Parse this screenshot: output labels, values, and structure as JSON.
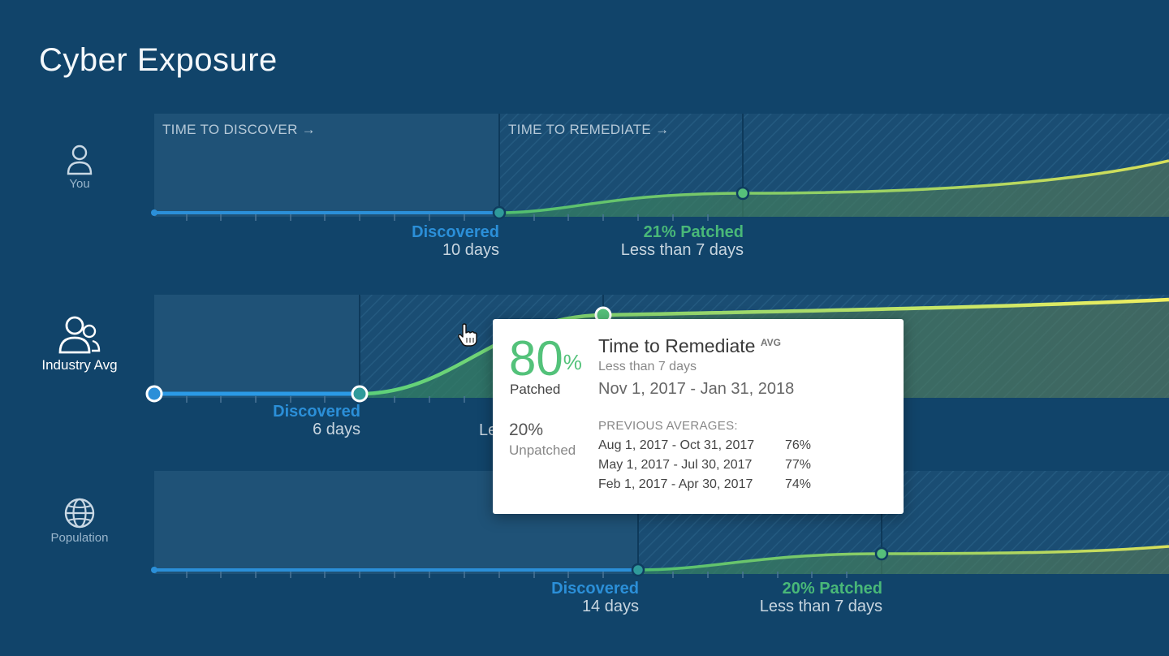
{
  "page": {
    "title": "Cyber Exposure"
  },
  "phases": {
    "discover": "TIME TO DISCOVER →",
    "remediate": "TIME TO REMEDIATE →"
  },
  "rows": [
    {
      "label": "You",
      "discovered_label": "Discovered",
      "discovered_days": "10 days",
      "patched_label": "21% Patched",
      "patched_days": "Less than 7 days"
    },
    {
      "label": "Industry Avg",
      "discovered_label": "Discovered",
      "discovered_days": "6 days",
      "partial_text": "Le"
    },
    {
      "label": "Population",
      "discovered_label": "Discovered",
      "discovered_days": "14 days",
      "patched_label": "20% Patched",
      "patched_days": "Less than 7 days"
    }
  ],
  "tooltip": {
    "percent": "80",
    "percent_sign": "%",
    "patched_label": "Patched",
    "unpatched_percent": "20%",
    "unpatched_label": "Unpatched",
    "heading": "Time to Remediate",
    "heading_badge": "AVG",
    "subheading": "Less than 7 days",
    "date_range": "Nov 1, 2017 - Jan 31, 2018",
    "previous_title": "PREVIOUS AVERAGES:",
    "previous": [
      {
        "dates": "Aug 1, 2017 - Oct 31, 2017",
        "value": "76%"
      },
      {
        "dates": "May 1, 2017 - Jul 30, 2017",
        "value": "77%"
      },
      {
        "dates": "Feb 1, 2017 - Apr 30, 2017",
        "value": "74%"
      }
    ]
  },
  "icons": {
    "you": "user-icon",
    "industry": "users-icon",
    "population": "globe-icon",
    "cursor": "hand-pointer-icon"
  },
  "colors": {
    "background": "#11446a",
    "discover_blue": "#2b8fd8",
    "patched_green": "#49b878",
    "trend_yellow": "#d8e05a"
  }
}
